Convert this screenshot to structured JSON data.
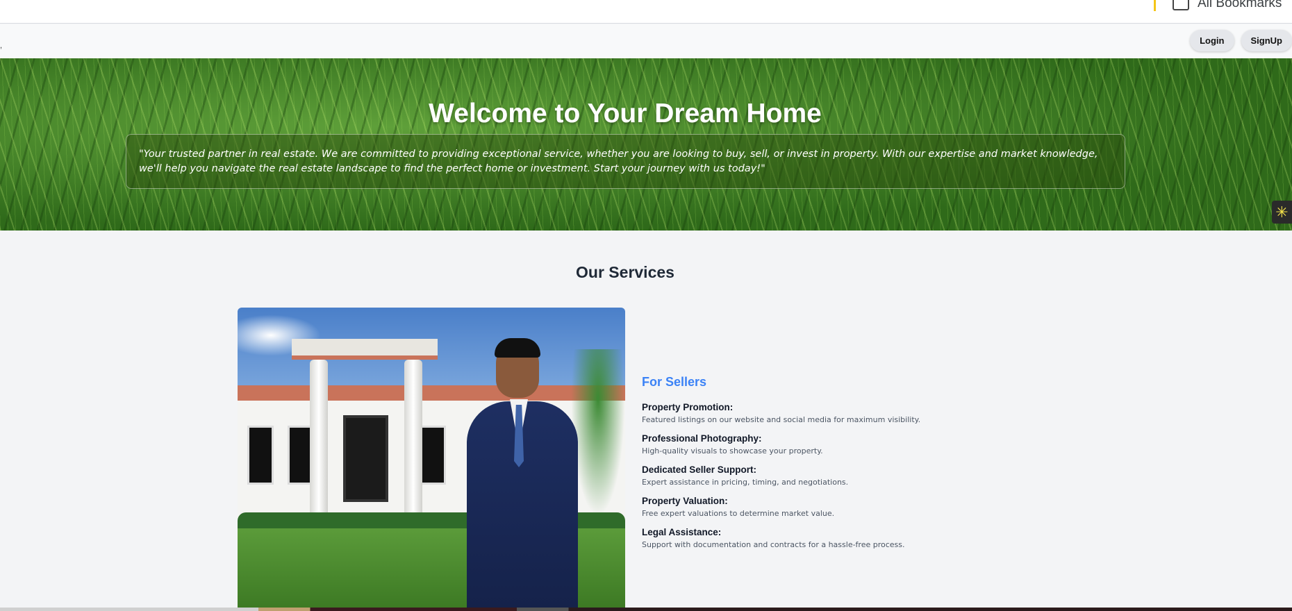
{
  "browser": {
    "bookmarks_all_label": "All Bookmarks"
  },
  "nav": {
    "left_mark": ",",
    "login_label": "Login",
    "signup_label": "SignUp"
  },
  "hero": {
    "title": "Welcome to Your Dream Home",
    "quote": "\"Your trusted partner in real estate. We are committed to providing exceptional service, whether you are looking to buy, sell, or invest in property. With our expertise and market knowledge, we'll help you navigate the real estate landscape to find the perfect home or investment. Start your journey with us today!\""
  },
  "chat_widget": {
    "icon": "sparkle-icon",
    "glyph": "✳"
  },
  "services": {
    "heading": "Our Services",
    "section_title": "For Sellers",
    "items": [
      {
        "title": "Property Promotion:",
        "desc": "Featured listings on our website and social media for maximum visibility."
      },
      {
        "title": "Professional Photography:",
        "desc": "High-quality visuals to showcase your property."
      },
      {
        "title": "Dedicated Seller Support:",
        "desc": "Expert assistance in pricing, timing, and negotiations."
      },
      {
        "title": "Property Valuation:",
        "desc": "Free expert valuations to determine market value."
      },
      {
        "title": "Legal Assistance:",
        "desc": "Support with documentation and contracts for a hassle-free process."
      }
    ]
  },
  "colors": {
    "accent": "#3b82f6",
    "hero_green": "#3d7a23",
    "page_bg": "#f3f4f6"
  }
}
